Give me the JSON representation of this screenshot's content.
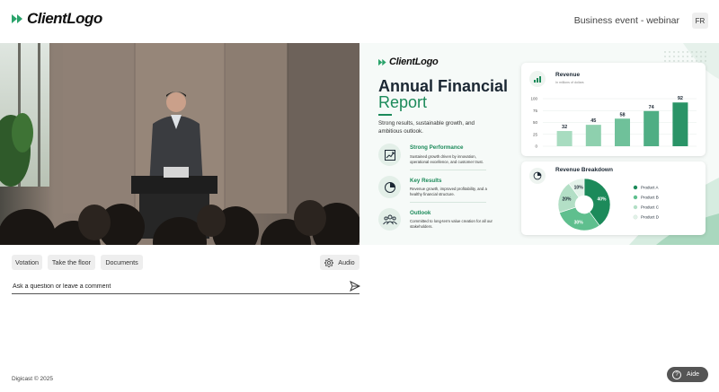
{
  "header": {
    "logo_text": "ClientLogo",
    "event_title": "Business event - webinar",
    "language_button": "FR"
  },
  "slide": {
    "logo_text": "ClientLogo",
    "title_line1": "Annual Financial",
    "title_line2": "Report",
    "subtitle": "Strong results, sustainable growth, and ambitious outlook.",
    "items": [
      {
        "title": "Strong Performance",
        "description": "Sustained growth driven by innovation, operational excellence, and customer trust.",
        "icon": "trend-up-icon"
      },
      {
        "title": "Key Results",
        "description": "Revenue growth, improved profitability, and a healthy financial structure.",
        "icon": "pie-icon"
      },
      {
        "title": "Outlook",
        "description": "Committed to long-term value creation for all our stakeholders.",
        "icon": "people-icon"
      }
    ],
    "revenue_card": {
      "title": "Revenue",
      "subtitle": "In millions of dollars"
    },
    "breakdown_card": {
      "title": "Revenue Breakdown"
    },
    "colors": {
      "accent": "#1c8a5a",
      "dark": "#1b2733"
    }
  },
  "chart_data": [
    {
      "type": "bar",
      "title": "Revenue",
      "subtitle": "In millions of dollars",
      "categories": [
        "",
        "",
        "",
        "",
        ""
      ],
      "values": [
        32,
        45,
        58,
        74,
        92
      ],
      "yticks": [
        0,
        25,
        50,
        75,
        100
      ],
      "ylim": [
        0,
        100
      ],
      "grid": true
    },
    {
      "type": "pie",
      "title": "Revenue Breakdown",
      "labels": [
        "Product A",
        "Product B",
        "Product C",
        "Product D"
      ],
      "values": [
        40,
        30,
        20,
        10
      ],
      "colors": [
        "#1c8a5a",
        "#5fbf8e",
        "#b3dfc6",
        "#e3f2e9"
      ],
      "legend": "right"
    }
  ],
  "controls": {
    "votation_label": "Votation",
    "take_floor_label": "Take the floor",
    "documents_label": "Documents",
    "audio_label": "Audio",
    "question_placeholder": "Ask a question or leave a comment"
  },
  "footer": {
    "copyright": "Digicast © 2025",
    "help_label": "Aide"
  }
}
